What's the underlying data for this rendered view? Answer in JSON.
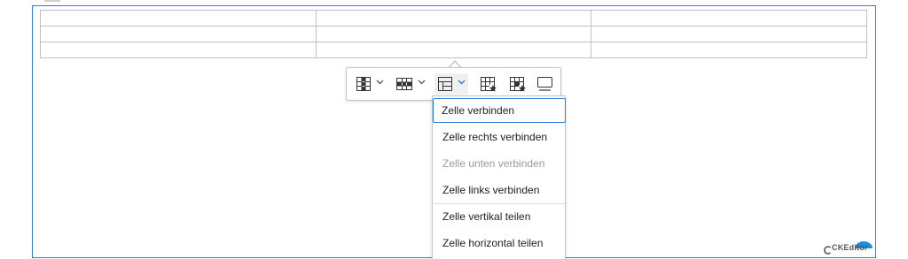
{
  "editor": {
    "table": {
      "rows": 3,
      "cols": 3
    }
  },
  "toolbar": {
    "buttons": [
      {
        "name": "column-icon",
        "has_dropdown": true
      },
      {
        "name": "row-icon",
        "has_dropdown": true
      },
      {
        "name": "merge-cells-icon",
        "has_dropdown": true,
        "active": true
      },
      {
        "name": "table-properties-icon",
        "has_dropdown": false
      },
      {
        "name": "cell-properties-icon",
        "has_dropdown": false
      },
      {
        "name": "caption-icon",
        "has_dropdown": false
      }
    ]
  },
  "dropdown": {
    "items": [
      {
        "label": "Zelle verbinden",
        "state": "focused"
      },
      {
        "label": "Zelle rechts verbinden",
        "state": "normal"
      },
      {
        "label": "Zelle unten verbinden",
        "state": "disabled"
      },
      {
        "label": "Zelle links verbinden",
        "state": "normal"
      },
      {
        "label": "Zelle vertikal teilen",
        "state": "normal"
      },
      {
        "label": "Zelle horizontal teilen",
        "state": "normal"
      }
    ]
  },
  "branding": {
    "logo_text": "CKEditor"
  },
  "colors": {
    "accent": "#2f7ce0",
    "border": "#bfbfbf",
    "disabled_text": "#9a9a9a",
    "logo_dome": "#1a8fe0"
  }
}
